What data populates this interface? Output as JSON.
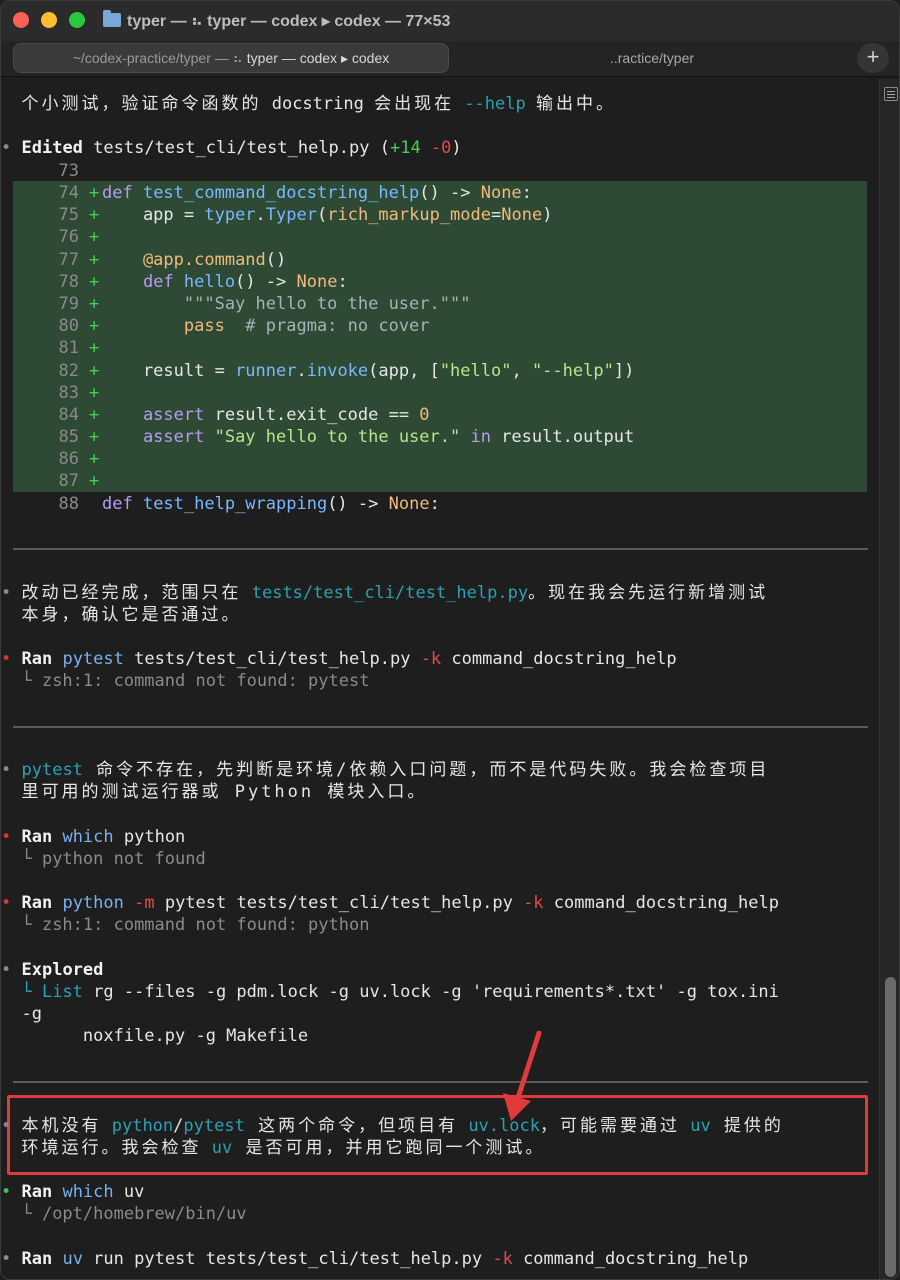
{
  "window": {
    "title": "typer — ⠦ typer — codex ▸ codex — 77×53"
  },
  "tabs": {
    "active_dim": "~/codex-practice/typer — ⠦ ",
    "active_main": "typer — codex ▸ codex",
    "inactive": "..ractice/typer",
    "new_tab": "+"
  },
  "terminal": {
    "l01_cjk": "个小测试，验证命令函数的",
    "l01_a": " docstring ",
    "l01_cjk2": "会出现在",
    "l01_help": " --help ",
    "l01_cjk3": "输出中。",
    "edit_bullet": "•",
    "edit_label": "Edited",
    "edit_file": " tests/test_cli/test_help.py (",
    "edit_plus": "+14",
    "edit_minus": " -0",
    "edit_close": ")",
    "diff": [
      {
        "num": "73",
        "sign": " "
      },
      {
        "num": "74",
        "sign": "+"
      },
      {
        "num": "75",
        "sign": "+"
      },
      {
        "num": "76",
        "sign": "+"
      },
      {
        "num": "77",
        "sign": "+"
      },
      {
        "num": "78",
        "sign": "+"
      },
      {
        "num": "79",
        "sign": "+"
      },
      {
        "num": "80",
        "sign": "+"
      },
      {
        "num": "81",
        "sign": "+"
      },
      {
        "num": "82",
        "sign": "+"
      },
      {
        "num": "83",
        "sign": "+"
      },
      {
        "num": "84",
        "sign": "+"
      },
      {
        "num": "85",
        "sign": "+"
      },
      {
        "num": "86",
        "sign": "+"
      },
      {
        "num": "87",
        "sign": "+"
      },
      {
        "num": "88",
        "sign": " "
      }
    ],
    "code": {
      "c74_def": "def ",
      "c74_fn": "test_command_docstring_help",
      "c74_rest": "() -> ",
      "c74_none": "None",
      "c74_colon": ":",
      "c75_a": "    app = ",
      "c75_b": "typer",
      "c75_c": ".",
      "c75_d": "Typer",
      "c75_e": "(",
      "c75_f": "rich_markup_mode",
      "c75_g": "=",
      "c75_h": "None",
      "c75_i": ")",
      "c77_a": "    @app.",
      "c77_b": "command",
      "c77_c": "()",
      "c78_def": "    def ",
      "c78_fn": "hello",
      "c78_rest": "() -> ",
      "c78_none": "None",
      "c78_colon": ":",
      "c79": "        \"\"\"Say hello to the user.\"\"\"",
      "c80_pass": "        pass",
      "c80_cmt": "  # pragma: no cover",
      "c82_a": "    result = ",
      "c82_b": "runner",
      "c82_c": ".",
      "c82_d": "invoke",
      "c82_e": "(app, [",
      "c82_f": "\"hello\"",
      "c82_g": ", ",
      "c82_h": "\"--help\"",
      "c82_i": "])",
      "c84_a": "    assert ",
      "c84_b": "result.exit_code == ",
      "c84_c": "0",
      "c85_a": "    assert ",
      "c85_b": "\"Say hello to the user.\"",
      "c85_c": " in ",
      "c85_d": "result.output",
      "c88_def": "def ",
      "c88_fn": "test_help_wrapping",
      "c88_rest": "() -> ",
      "c88_none": "None",
      "c88_colon": ":"
    },
    "m1_cjk": "改动已经完成，范围只在",
    "m1_path": " tests/test_cli/test_help.py",
    "m1_cjk2": "。现在我会先运行新增测试",
    "m1_line2": "本身，确认它是否通过。",
    "run1_label": "Ran",
    "run1_cmd": " pytest",
    "run1_rest": " tests/test_cli/test_help.py ",
    "run1_k": "-k",
    "run1_arg": " command_docstring_help",
    "run1_out": "└ zsh:1: command not found: pytest",
    "m2_cmd": "pytest",
    "m2_cjk": " 命令不存在，先判断是环境/依赖入口问题，而不是代码失败。我会检查项目",
    "m2_line2": "里可用的测试运行器或 Python 模块入口。",
    "run2_label": "Ran",
    "run2_cmd": " which",
    "run2_arg": " python",
    "run2_out": "└ python not found",
    "run3_label": "Ran",
    "run3_cmd": " python",
    "run3_m": " -m",
    "run3_rest": " pytest tests/test_cli/test_help.py ",
    "run3_k": "-k",
    "run3_arg": " command_docstring_help",
    "run3_out": "└ zsh:1: command not found: python",
    "explored_label": "Explored",
    "explored_list": "└ List",
    "explored_rest": " rg --files -g pdm.lock -g uv.lock -g 'requirements*.txt' -g tox.ini",
    "explored_l2": "-g",
    "explored_l3": "      noxfile.py -g Makefile",
    "m3_a": "本机没有",
    "m3_python": " python",
    "m3_slash": "/",
    "m3_pytest": "pytest",
    "m3_b": " 这两个命令，但项目有",
    "m3_uvlock": " uv.lock",
    "m3_c": "，可能需要通过",
    "m3_uv": " uv",
    "m3_d": " 提供的",
    "m3_line2a": "环境运行。我会检查",
    "m3_line2uv": " uv",
    "m3_line2b": " 是否可用，并用它跑同一个测试。",
    "run4_label": "Ran",
    "run4_cmd": " which",
    "run4_arg": " uv",
    "run4_out": "└ /opt/homebrew/bin/uv",
    "run5_label": "Ran",
    "run5_cmd": " uv",
    "run5_rest": " run pytest tests/test_cli/test_help.py ",
    "run5_k": "-k",
    "run5_arg": " command_docstring_help"
  },
  "colors": {
    "diff_added_bg": "#2e4a35",
    "annotation_red": "#e03a3a",
    "accent_cyan": "#2aa1b3"
  }
}
